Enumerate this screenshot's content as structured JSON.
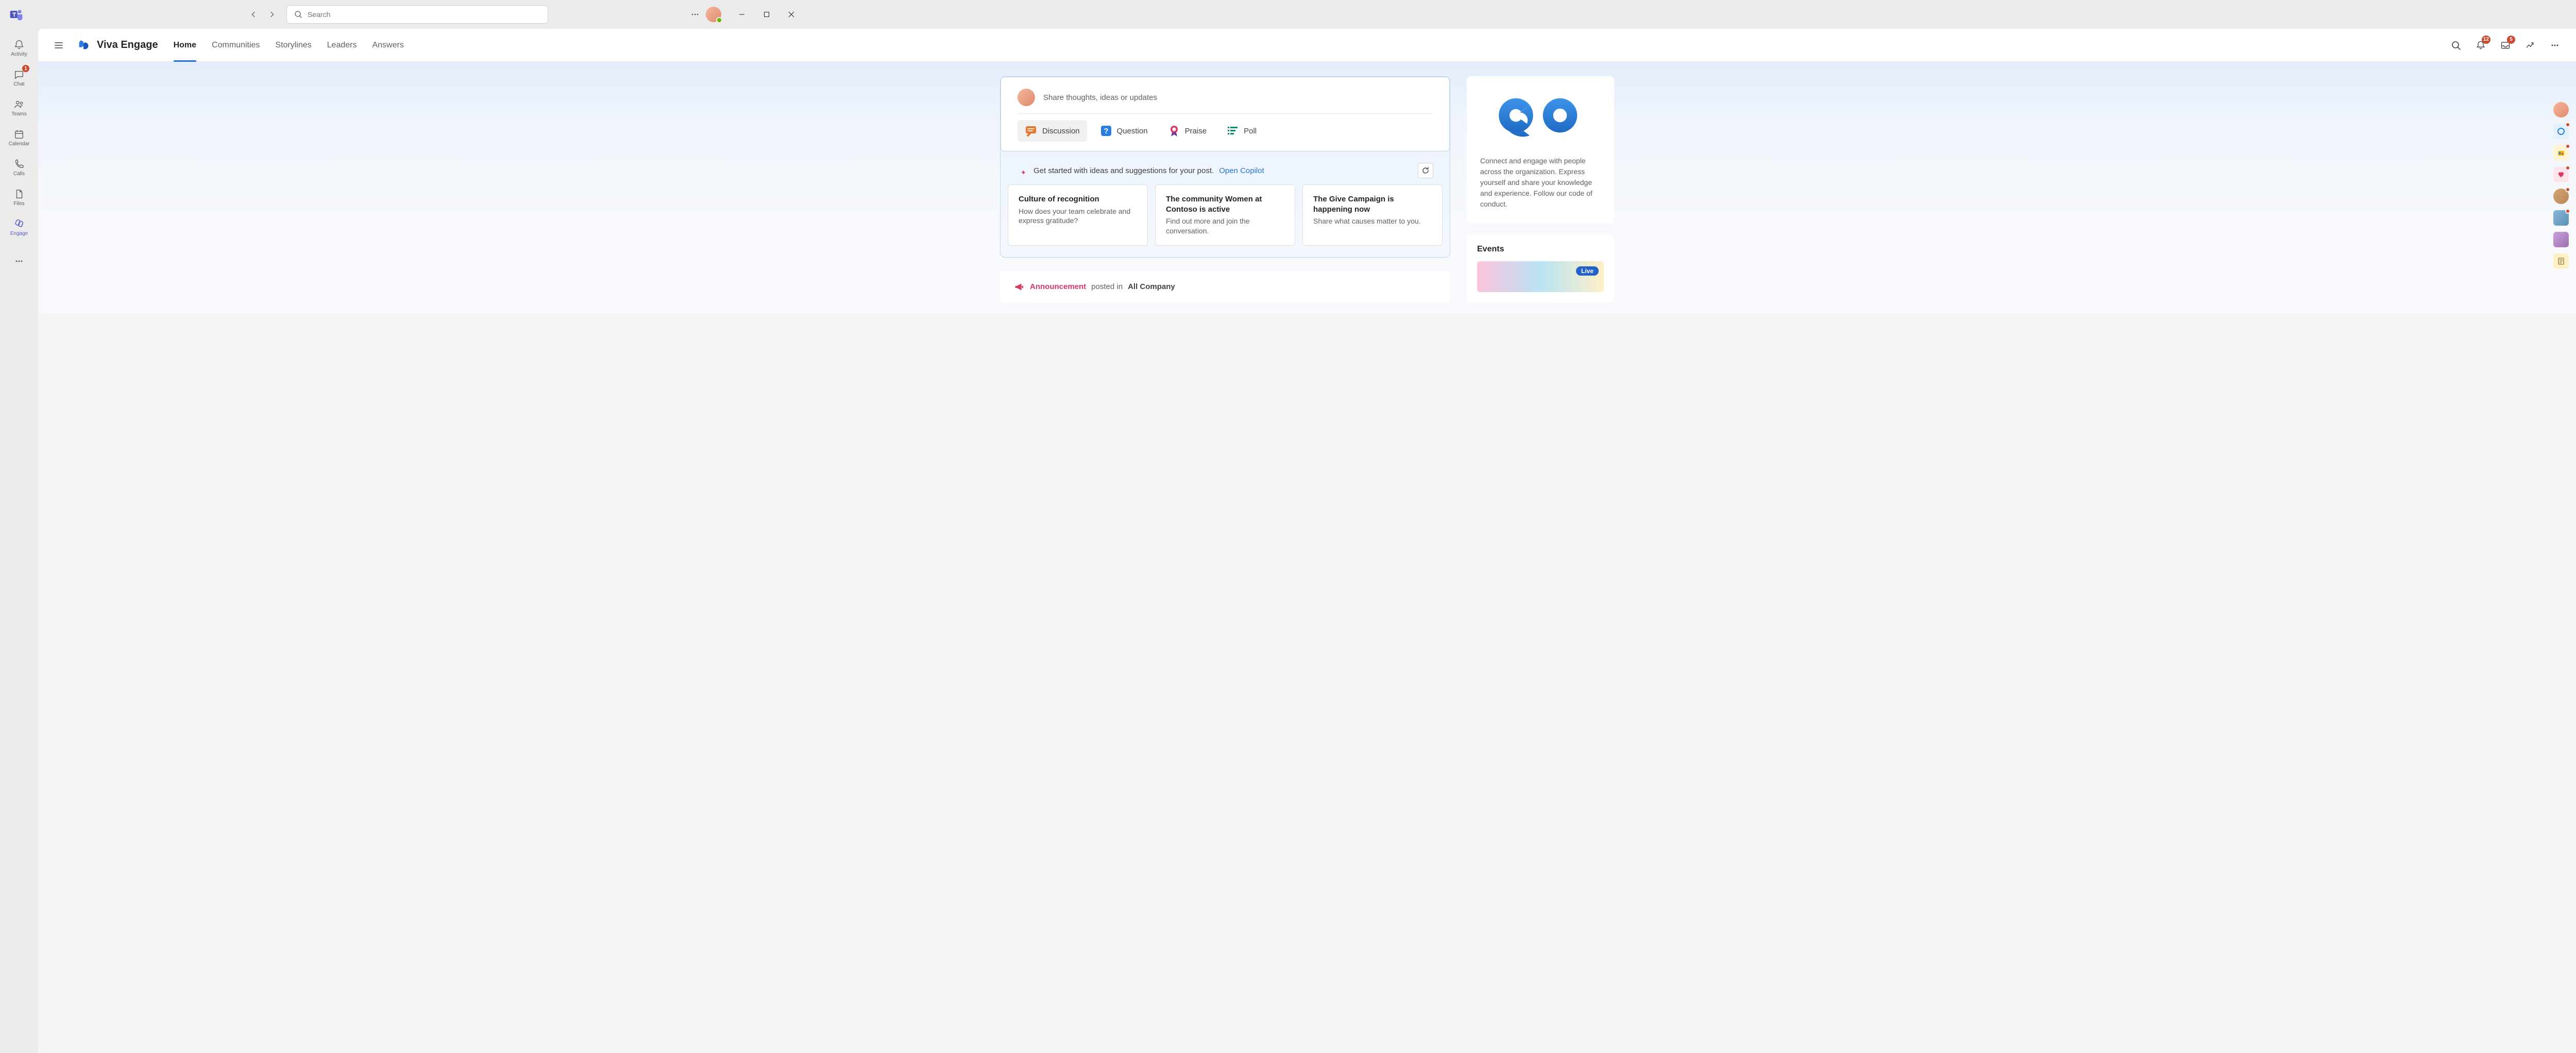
{
  "titlebar": {
    "search_placeholder": "Search"
  },
  "rail": {
    "items": [
      {
        "label": "Activity"
      },
      {
        "label": "Chat",
        "badge": "1"
      },
      {
        "label": "Teams"
      },
      {
        "label": "Calendar"
      },
      {
        "label": "Calls"
      },
      {
        "label": "Files"
      },
      {
        "label": "Engage"
      }
    ]
  },
  "header": {
    "app_title": "Viva Engage",
    "tabs": [
      {
        "label": "Home"
      },
      {
        "label": "Communities"
      },
      {
        "label": "Storylines"
      },
      {
        "label": "Leaders"
      },
      {
        "label": "Answers"
      }
    ],
    "notif_badge": "12",
    "inbox_badge": "5"
  },
  "compose": {
    "placeholder": "Share thoughts, ideas or updates",
    "types": [
      {
        "label": "Discussion"
      },
      {
        "label": "Question"
      },
      {
        "label": "Praise"
      },
      {
        "label": "Poll"
      }
    ],
    "copilot_text": "Get started with ideas and suggestions for your post.",
    "copilot_link": "Open Copilot",
    "suggestions": [
      {
        "title": "Culture of recognition",
        "desc": "How does your team celebrate and express gratitude?"
      },
      {
        "title": "The community Women at Contoso is active",
        "desc": "Find out more and join the conversation."
      },
      {
        "title": "The Give Campaign is happening now",
        "desc": "Share what causes matter to you."
      }
    ]
  },
  "feed": {
    "announce_label": "Announcement",
    "announce_in": "posted in",
    "announce_location": "All Company"
  },
  "side": {
    "about_text": "Connect and engage with people across the organization. Express yourself and share your knowledge and experience. Follow our code of conduct.",
    "events_title": "Events",
    "live_label": "Live"
  }
}
